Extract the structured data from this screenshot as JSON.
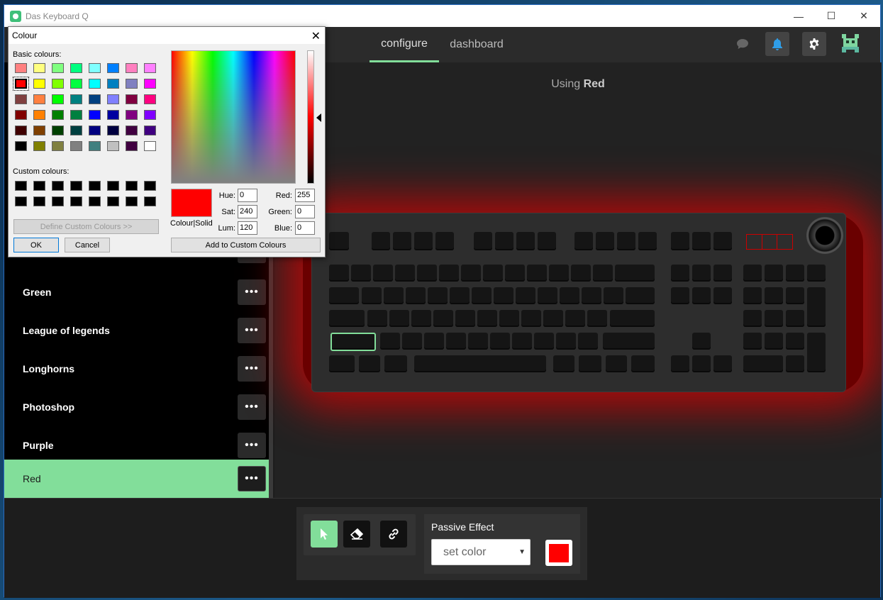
{
  "app": {
    "title": "Das Keyboard Q"
  },
  "window_controls": {
    "minimize": "—",
    "maximize": "☐",
    "close": "✕"
  },
  "nav": {
    "tabs": [
      {
        "label": "configure",
        "active": true
      },
      {
        "label": "dashboard",
        "active": false
      }
    ]
  },
  "main": {
    "using_prefix": "Using",
    "using_name": "Red"
  },
  "profiles": [
    {
      "label": "Green"
    },
    {
      "label": "League of legends"
    },
    {
      "label": "Longhorns"
    },
    {
      "label": "Photoshop"
    },
    {
      "label": "Purple"
    },
    {
      "label": "Red",
      "active": true
    }
  ],
  "more_label": "•••",
  "toolbar": {
    "passive_effect_title": "Passive Effect",
    "effect_selected": "set color",
    "effect_color": "#ff0000"
  },
  "colour_dialog": {
    "title": "Colour",
    "basic_label": "Basic colours:",
    "custom_label": "Custom colours:",
    "define_custom": "Define Custom Colours >>",
    "ok": "OK",
    "cancel": "Cancel",
    "add_custom": "Add to Custom Colours",
    "preview_label": "Colour|Solid",
    "hue_label": "Hue:",
    "hue": "0",
    "sat_label": "Sat:",
    "sat": "240",
    "lum_label": "Lum:",
    "lum": "120",
    "red_label": "Red:",
    "red": "255",
    "green_label": "Green:",
    "green": "0",
    "blue_label": "Blue:",
    "blue": "0",
    "basic_colours": [
      [
        "#ff8080",
        "#ffff80",
        "#80ff80",
        "#00ff80",
        "#80ffff",
        "#0080ff",
        "#ff80c0",
        "#ff80ff"
      ],
      [
        "#ff0000",
        "#ffff00",
        "#80ff00",
        "#00ff40",
        "#00ffff",
        "#0080c0",
        "#8080c0",
        "#ff00ff"
      ],
      [
        "#804040",
        "#ff8040",
        "#00ff00",
        "#008080",
        "#004080",
        "#8080ff",
        "#800040",
        "#ff0080"
      ],
      [
        "#800000",
        "#ff8000",
        "#008000",
        "#008040",
        "#0000ff",
        "#0000a0",
        "#800080",
        "#8000ff"
      ],
      [
        "#400000",
        "#804000",
        "#004000",
        "#004040",
        "#000080",
        "#000040",
        "#400040",
        "#400080"
      ],
      [
        "#000000",
        "#808000",
        "#808040",
        "#808080",
        "#408080",
        "#c0c0c0",
        "#400040",
        "#ffffff"
      ]
    ],
    "custom_colours": [
      "#000000",
      "#000000",
      "#000000",
      "#000000",
      "#000000",
      "#000000",
      "#000000",
      "#000000",
      "#000000",
      "#000000",
      "#000000",
      "#000000",
      "#000000",
      "#000000",
      "#000000",
      "#000000"
    ]
  },
  "colors": {
    "accent": "#82de9a",
    "key_legend": "#b71010"
  }
}
